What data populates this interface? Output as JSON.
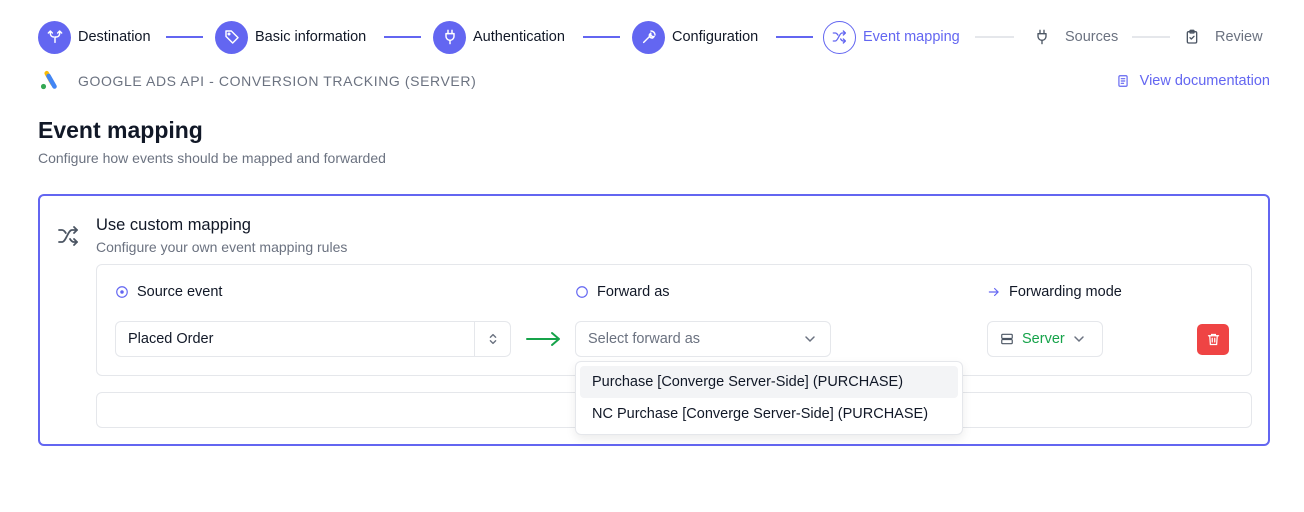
{
  "stepper": {
    "steps": [
      {
        "label": "Destination",
        "state": "done",
        "icon": "split-icon"
      },
      {
        "label": "Basic information",
        "state": "done",
        "icon": "tag-icon"
      },
      {
        "label": "Authentication",
        "state": "done",
        "icon": "plug-icon"
      },
      {
        "label": "Configuration",
        "state": "done",
        "icon": "wrench-icon"
      },
      {
        "label": "Event mapping",
        "state": "current",
        "icon": "shuffle-icon"
      },
      {
        "label": "Sources",
        "state": "todo",
        "icon": "plug-icon"
      },
      {
        "label": "Review",
        "state": "todo",
        "icon": "clipboard-check-icon"
      }
    ]
  },
  "destination": {
    "name": "GOOGLE ADS API - CONVERSION TRACKING (SERVER)",
    "docs_link": "View documentation"
  },
  "page": {
    "title": "Event mapping",
    "description": "Configure how events should be mapped and forwarded"
  },
  "mapping": {
    "title": "Use custom mapping",
    "subtitle": "Configure your own event mapping rules",
    "headers": {
      "source": "Source event",
      "forward": "Forward as",
      "mode": "Forwarding mode"
    },
    "source_value": "Placed Order",
    "forward_placeholder": "Select forward as",
    "mode_value": "Server",
    "forward_options": [
      "Purchase [Converge Server-Side] (PURCHASE)",
      "NC Purchase [Converge Server-Side] (PURCHASE)"
    ]
  },
  "colors": {
    "accent": "#6366f1",
    "success": "#16a34a",
    "danger": "#ef4444",
    "muted": "#6b7280"
  }
}
